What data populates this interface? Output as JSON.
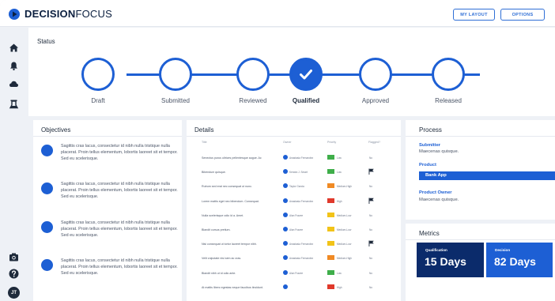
{
  "header": {
    "brand_bold": "DECISION",
    "brand_light": "FOCUS",
    "my_layout_label": "MY LAYOUT",
    "options_label": "OPTIONS"
  },
  "sidebar": {
    "icons": [
      "home-icon",
      "bell-icon",
      "cloud-icon",
      "flask-icon",
      "camera-icon",
      "help-icon"
    ],
    "avatar_initials": "JT"
  },
  "status": {
    "title": "Status",
    "steps": [
      {
        "label": "Draft",
        "state": "done"
      },
      {
        "label": "Submitted",
        "state": "done"
      },
      {
        "label": "Reviewed",
        "state": "done"
      },
      {
        "label": "Qualified",
        "state": "current"
      },
      {
        "label": "Approved",
        "state": "pending"
      },
      {
        "label": "Released",
        "state": "pending"
      }
    ]
  },
  "objectives": {
    "title": "Objectives",
    "items": [
      "Sagittis cras lacus, consectetur id nibh nulla tristique nulla placerat. Proin tellus elementum, lobortis laoreet sit et tempor. Sed eu scelerisque.",
      "Sagittis cras lacus, consectetur id nibh nulla tristique nulla placerat. Proin tellus elementum, lobortis laoreet sit et tempor. Sed eu scelerisque.",
      "Sagittis cras lacus, consectetur id nibh nulla tristique nulla placerat. Proin tellus elementum, lobortis laoreet sit et tempor. Sed eu scelerisque.",
      "Sagittis cras lacus, consectetur id nibh nulla tristique nulla placerat. Proin tellus elementum, lobortis laoreet sit et tempor. Sed eu scelerisque."
    ]
  },
  "details": {
    "title": "Details",
    "columns": [
      "Title",
      "Owner",
      "Priority",
      "Flagged?"
    ],
    "rows": [
      {
        "title": "Senectus purus ultrices pellentesque augue. Ac",
        "owner": "Anastasia Fernandez",
        "priority": "Low",
        "priority_color": "#3fae4a",
        "flagged": false
      },
      {
        "title": "Bibendum quisque.",
        "owner": "Kendra J. Smart",
        "priority": "Low",
        "priority_color": "#3fae4a",
        "flagged": true
      },
      {
        "title": "Rutrum sed erat nec consequat ut nunc.",
        "owner": "Taylor Garcia",
        "priority": "Medium-High",
        "priority_color": "#f08a24",
        "flagged": false
      },
      {
        "title": "Lorem mattis eget nec bibendum. Consequat.",
        "owner": "Anastasia Fernandez",
        "priority": "High",
        "priority_color": "#e0392b",
        "flagged": true
      },
      {
        "title": "Nulla scelerisque odio id a. Amet.",
        "owner": "Alan Frazee",
        "priority": "Medium-Low",
        "priority_color": "#f2c318",
        "flagged": false
      },
      {
        "title": "Blandit cursus pretium.",
        "owner": "Alan Frazee",
        "priority": "Medium-Low",
        "priority_color": "#f2c318",
        "flagged": false
      },
      {
        "title": "Nisi consequat ut tortor laoreet tempor nibh.",
        "owner": "Anastasia Fernandez",
        "priority": "Medium-Low",
        "priority_color": "#f2c318",
        "flagged": true
      },
      {
        "title": "Velit vulputate nisi sem ac cras.",
        "owner": "Anastasia Fernandez",
        "priority": "Medium-High",
        "priority_color": "#f08a24",
        "flagged": false
      },
      {
        "title": "Blandit nibh ut id odio ante.",
        "owner": "Alan Frazee",
        "priority": "Low",
        "priority_color": "#3fae4a",
        "flagged": false
      },
      {
        "title": "At mattis libero egestas neque faucibus tincidunt.",
        "owner": "",
        "priority": "High",
        "priority_color": "#e0392b",
        "flagged": false
      }
    ]
  },
  "process": {
    "title": "Process",
    "submitter_label": "Submitter",
    "submitter_value": "Maecenas quisque.",
    "product_label": "Product",
    "product_value": "Bank App",
    "owner_label": "Product Owner",
    "owner_value": "Maecenas quisque."
  },
  "metrics": {
    "title": "Metrics",
    "qualification_label": "Qualification",
    "qualification_value": "15 Days",
    "decision_label": "Decision",
    "decision_value": "82 Days"
  },
  "colors": {
    "accent": "#1d5fd4",
    "navy": "#0b2b6b",
    "background": "#eef1f6"
  }
}
